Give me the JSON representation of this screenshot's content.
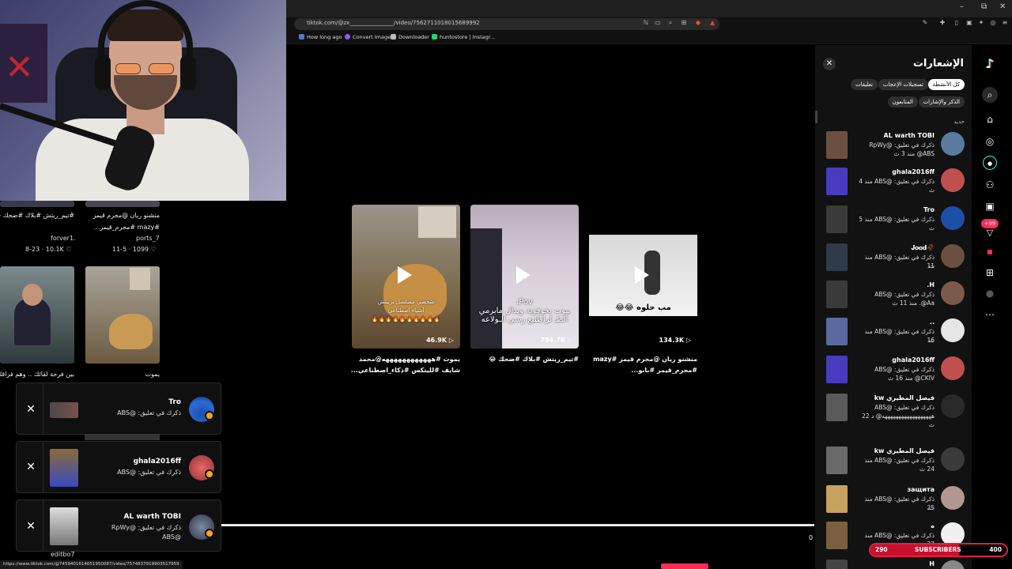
{
  "browser": {
    "url": "tiktok.com/@zx________________/video/7562711018015689992",
    "bookmarks": [
      "How long ago",
      "Convert Image",
      "Downloader",
      "huntostore | Instagr..."
    ],
    "window_controls": [
      "–",
      "⧉",
      "✕"
    ],
    "hover_status_url": "https://www.tiktok.com/@7459401614651950087/video/7574837919903517959"
  },
  "left_grid": {
    "posts": [
      {
        "caption": "#تيم_ريتش #بلاك #ضحك 😂",
        "caption2": "",
        "user": "forver1.",
        "meta": "8-23 · 10.1K ♡"
      },
      {
        "caption": "منشنو ريان @مجرم قيمز",
        "caption2": "#mazy #مجرم_قيمز...",
        "user": "ports_7",
        "meta": "11-5 · 1099 ♡"
      }
    ],
    "captions_bottom": [
      "بين فرحة لقائك .. وهم فراقك يا",
      "يموت"
    ],
    "partial_user": "editbo7"
  },
  "toasts": [
    {
      "name": "Tro",
      "line1": "ذكرك في تعليق: @ABS",
      "line2": ""
    },
    {
      "name": "ghala2016ff",
      "line1": "ذكرك في تعليق: @ABS",
      "line2": ""
    },
    {
      "name": "AL warth TOBI",
      "line1": "ذكرك في تعليق: @RpWy",
      "line2": "@ABS"
    }
  ],
  "videos": [
    {
      "views": "46.9K",
      "overlay": "شخصي مسلسل بربيتش\nأشياء اصطناعي\n🔥🔥🔥🔥🔥🔥🔥🔥🔥🔥",
      "caption": "يموت #ههههههههههههه@محمد شايف #لليتكس #ذكاء_اصطناعي..."
    },
    {
      "views": "794.7K",
      "overlay": "Pov:\nبيوت بخوفونه وبدال مابرمي\nالطـ لراطنيع رسي الـولاعه",
      "caption": "#تيم_ريتش #بلاك #ضحك 😂"
    },
    {
      "views": "134.3K",
      "overlay": "مب حلوه 😂😂",
      "caption": "منشنو ريان @مجرم قيمز #mazy #مجرم_قيمز #بابو..."
    }
  ],
  "video_time_end": "0",
  "panel": {
    "title": "الإشعارات",
    "tabs": [
      "كل الأنشطة",
      "تسجيلات الإعجاب",
      "تعليقات",
      "الذكر والإشارات",
      "المتابعون"
    ],
    "new_label": "جديد",
    "notifications": [
      {
        "name": "AL warth TOBI",
        "line1": "ذكرك في تعليق: @RpWy",
        "line2": "ABS@ منذ 3 ث"
      },
      {
        "name": "ghala2016ff",
        "line1": "ذكرك في تعليق: @ABS منذ 4",
        "line2": "ث"
      },
      {
        "name": "Tro",
        "line1": "ذكرك في تعليق: @ABS منذ 5 ث",
        "line2": ""
      },
      {
        "name": "🥀𝐉𝐨𝐨𝐝",
        "line1": "ذكرك في تعليق: @ABS منذ 11",
        "line2": "ث"
      },
      {
        "name": "H.",
        "line1": "ذكرك في تعليق: @ABS",
        "line2": "Aa@. منذ 11 ث"
      },
      {
        "name": "..",
        "line1": "ذكرك في تعليق: @ABS منذ 16",
        "line2": "ث"
      },
      {
        "name": "ghala2016ff",
        "line1": "ذكرك في تعليق: @ABS",
        "line2": "CKIV@ منذ 16 ث"
      },
      {
        "name": "فيصل المطيري kw",
        "line1": "ذكرك في تعليق: @ABS",
        "line2": "ههههههههههههههههههه@ د 22 ث"
      },
      {
        "name": "فيصل المطيري kw",
        "line1": "ذكرك في تعليق: @ABS منذ",
        "line2": "24 ث"
      },
      {
        "name": "защита",
        "line1": "ذكرك في تعليق: @ABS منذ 25",
        "line2": "ث"
      },
      {
        "name": "ه",
        "line1": "ذكرك في تعليق: @ABS منذ 27",
        "line2": ""
      },
      {
        "name": "H",
        "line1": "",
        "line2": ""
      }
    ]
  },
  "rail": {
    "badge": "+99"
  },
  "subscribers": {
    "current": "290",
    "label": "SUBSCRIBERS",
    "goal": "400",
    "progress_fraction": 0.725
  },
  "colors": {
    "accent": "#fe2c55",
    "subs_red": "#e0223b",
    "panel_bg": "#121212"
  }
}
